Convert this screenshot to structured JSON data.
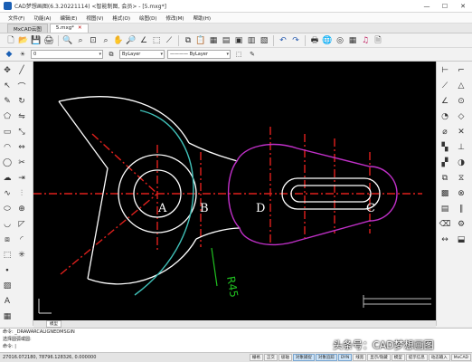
{
  "window": {
    "title": "CAD梦想画图(6.3.20221114) <智能制图, 会员> - [5.mxg*]",
    "minimize": "—",
    "maximize": "☐",
    "close": "✕"
  },
  "menu": [
    "文件(F)",
    "功能(A)",
    "编辑(E)",
    "视图(V)",
    "格式(O)",
    "绘图(D)",
    "修改(M)",
    "帮助(H)"
  ],
  "tabs": [
    {
      "label": "MxCAD云图"
    },
    {
      "label": "5.mxg*"
    }
  ],
  "toolbar2": {
    "layer_value": "0",
    "color_value": "ByLayer",
    "linetype_value": "———— ByLayer"
  },
  "drawing": {
    "labels": {
      "a": "A",
      "b": "B",
      "c": "C",
      "d": "D"
    },
    "dimension": "R45"
  },
  "layout_tabs": {
    "model": "模型"
  },
  "command": {
    "line1": "命令:  _DRAWARCALIGNEDMSGIN",
    "line2": "  选择圆弧或圆:",
    "prompt": "命令:"
  },
  "status": {
    "coordinates": "27016.072180, 78796.128326, 0.000000",
    "buttons": [
      "栅格",
      "正交",
      "极轴",
      "对象捕捉",
      "对象追踪",
      "DYN",
      "线宽",
      "显示/隐藏",
      "模型",
      "提示信息",
      "动态输入",
      "MxCAD"
    ]
  },
  "watermark": "头条号：CAD梦想画图",
  "colors": {
    "canvas": "#000000",
    "center_line": "#e0201c",
    "outline": "#ffffff",
    "arc_cyan": "#40c0b8",
    "magenta": "#c030c8",
    "dimension": "#20c020"
  }
}
